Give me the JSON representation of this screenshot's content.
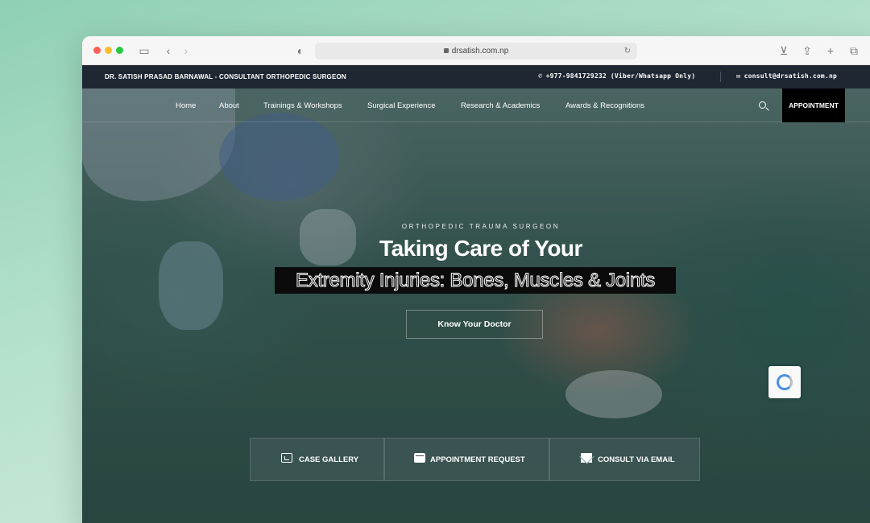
{
  "browser": {
    "url": "drsatish.com.np"
  },
  "topbar": {
    "doctor": "DR. SATISH PRASAD BARNAWAL - CONSULTANT ORTHOPEDIC SURGEON",
    "phone": "+977-9841729232 (Viber/Whatsapp Only)",
    "email": "consult@drsatish.com.np"
  },
  "nav": {
    "items": [
      "Home",
      "About",
      "Trainings & Workshops",
      "Surgical Experience",
      "Research & Academics",
      "Awards & Recognitions"
    ],
    "appointment": "APPOINTMENT"
  },
  "hero": {
    "eyebrow": "ORTHOPEDIC TRAUMA SURGEON",
    "title": "Taking Care of Your",
    "subtitle": "Extremity Injuries: Bones, Muscles & Joints",
    "cta": "Know Your Doctor"
  },
  "quick_links": [
    {
      "label": "CASE GALLERY",
      "icon": "image-icon"
    },
    {
      "label": "APPOINTMENT REQUEST",
      "icon": "calendar-icon"
    },
    {
      "label": "CONSULT VIA EMAIL",
      "icon": "envelope-icon"
    }
  ],
  "colors": {
    "topbar_bg": "#1f2733",
    "appointment_bg": "#000000",
    "hero_overlay": "#2f4f49"
  }
}
